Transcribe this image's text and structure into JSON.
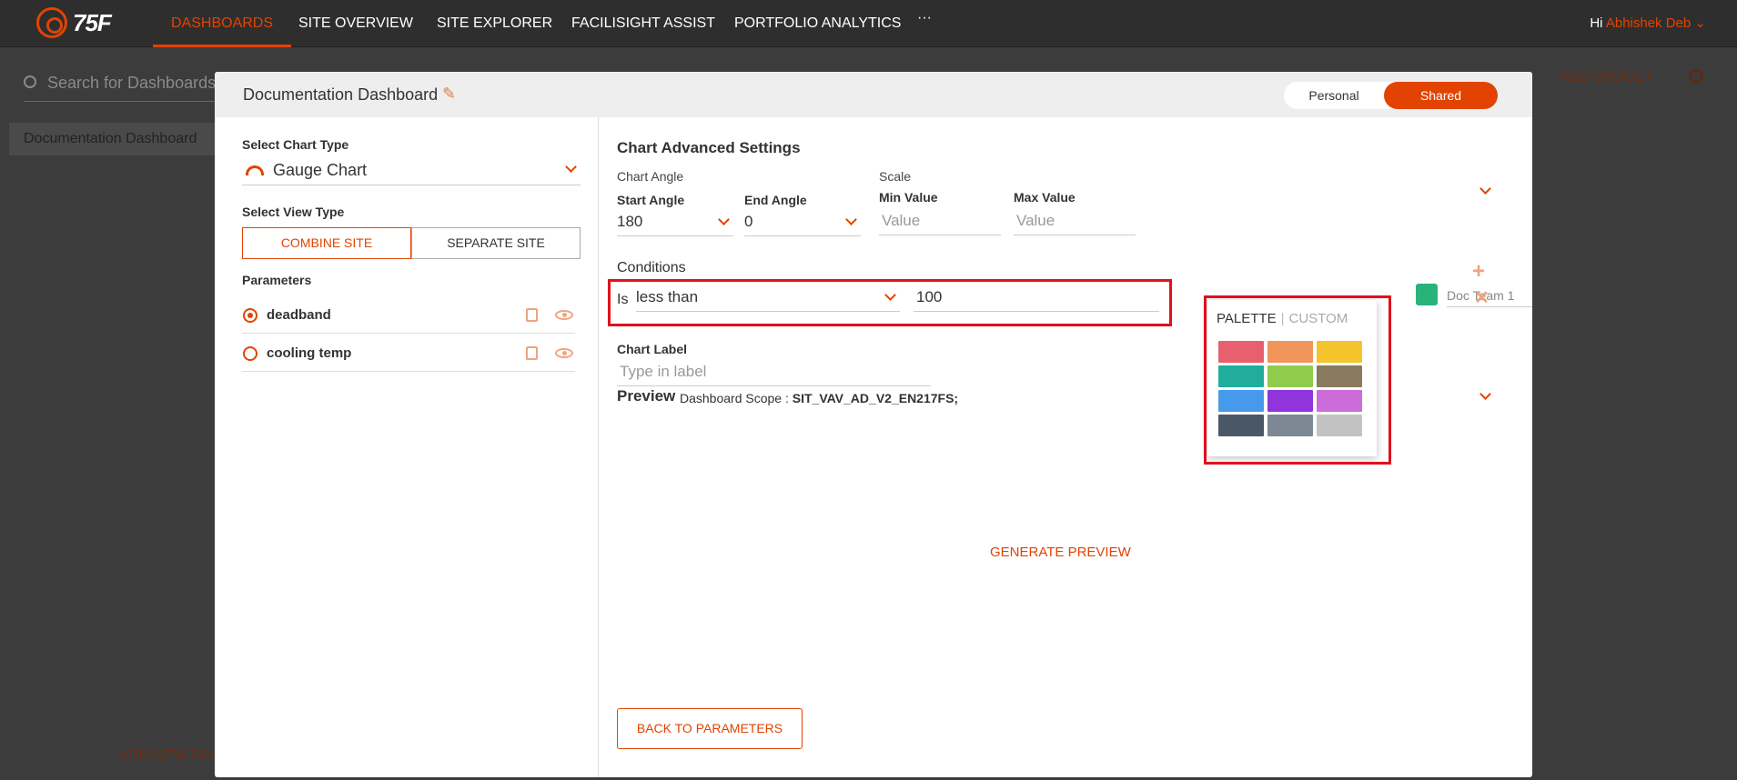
{
  "nav": {
    "logo": "75F",
    "items": [
      "DASHBOARDS",
      "SITE OVERVIEW",
      "SITE EXPLORER",
      "FACILISIGHT ASSIST",
      "PORTFOLIO ANALYTICS",
      "···"
    ],
    "greeting": "Hi",
    "user": "Abhishek Deb"
  },
  "background": {
    "search_placeholder": "Search for Dashboards",
    "sidebar_item": "Documentation Dashboard",
    "add_widget": "ADD WIDGET",
    "add_new": "ADD NEW DAS"
  },
  "modal": {
    "title": "Documentation Dashboard",
    "toggle": {
      "personal": "Personal",
      "shared": "Shared"
    },
    "left": {
      "chart_type_label": "Select Chart Type",
      "chart_type_value": "Gauge Chart",
      "view_type_label": "Select View Type",
      "view_combine": "COMBINE SITE",
      "view_separate": "SEPARATE SITE",
      "parameters_label": "Parameters",
      "parameters": [
        {
          "name": "deadband",
          "selected": true
        },
        {
          "name": "cooling temp",
          "selected": false
        }
      ]
    },
    "right": {
      "advanced_title": "Chart Advanced Settings",
      "chart_angle_label": "Chart Angle",
      "start_angle_label": "Start Angle",
      "start_angle_value": "180",
      "end_angle_label": "End Angle",
      "end_angle_value": "0",
      "scale_label": "Scale",
      "min_label": "Min Value",
      "min_placeholder": "Value",
      "max_label": "Max Value",
      "max_placeholder": "Value",
      "conditions_label": "Conditions",
      "cond_is": "Is",
      "cond_operator": "less than",
      "cond_value": "100",
      "cond_text": "Doc Team 1",
      "chart_label_label": "Chart Label",
      "chart_label_placeholder": "Type in label",
      "preview_label": "Preview",
      "scope_label": "Dashboard Scope :",
      "scope_value": "SIT_VAV_AD_V2_EN217FS;",
      "generate_preview": "GENERATE PREVIEW",
      "back_button": "BACK TO PARAMETERS"
    },
    "palette": {
      "tab_palette": "PALETTE",
      "tab_separator": "|",
      "tab_custom": "CUSTOM",
      "colors": [
        "#e8606e",
        "#f0965a",
        "#f5c42c",
        "#20ad9c",
        "#8fcc4e",
        "#8a7a5e",
        "#4799ec",
        "#9035dc",
        "#cc6cdb",
        "#4a5866",
        "#7c8893",
        "#c2c2c2"
      ]
    }
  }
}
